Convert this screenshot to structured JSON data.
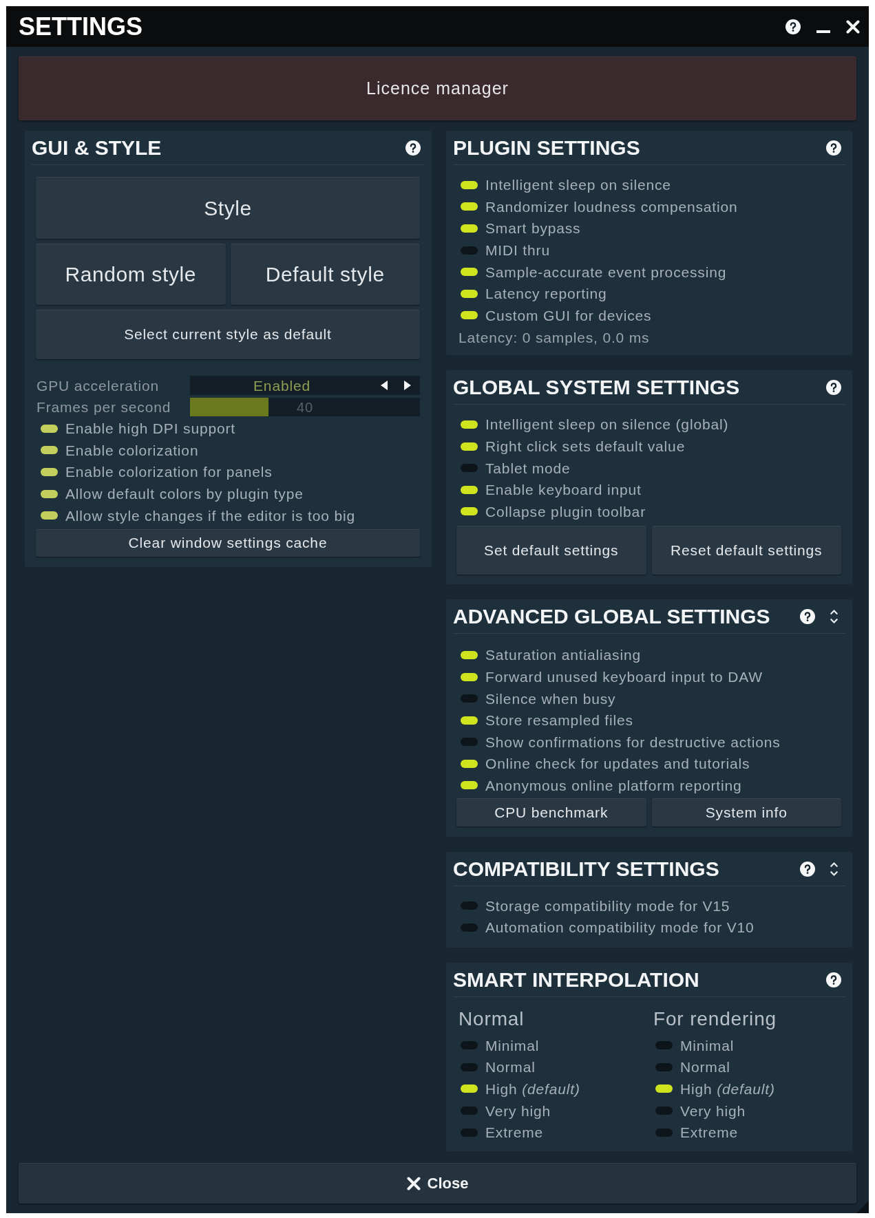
{
  "window": {
    "title": "SETTINGS"
  },
  "licence_button": "Licence manager",
  "gui_style": {
    "title": "GUI & STYLE",
    "collapsible": false,
    "style_button": "Style",
    "style_buttons": [
      "Random style",
      "Default style"
    ],
    "select_default_button": "Select current style as default",
    "gpu_acceleration": {
      "label": "GPU acceleration",
      "value": "Enabled"
    },
    "frames_per_second": {
      "label": "Frames per second",
      "level": 0.34,
      "reading": "40"
    },
    "options": [
      {
        "label": "Enable high DPI support",
        "on": true
      },
      {
        "label": "Enable colorization",
        "on": true
      },
      {
        "label": "Enable colorization for panels",
        "on": true
      },
      {
        "label": "Allow default colors by plugin type",
        "on": true
      },
      {
        "label": "Allow style changes if the editor is too big",
        "on": true
      }
    ],
    "clear_cache_button": "Clear window settings cache"
  },
  "plugin_settings": {
    "title": "PLUGIN SETTINGS",
    "collapsible": false,
    "options": [
      {
        "label": "Intelligent sleep on silence",
        "on": true
      },
      {
        "label": "Randomizer loudness compensation",
        "on": true
      },
      {
        "label": "Smart bypass",
        "on": true
      },
      {
        "label": "MIDI thru",
        "on": false
      },
      {
        "label": "Sample-accurate event processing",
        "on": true
      },
      {
        "label": "Latency reporting",
        "on": true
      },
      {
        "label": "Custom GUI for devices",
        "on": true
      }
    ],
    "latency": "Latency: 0 samples, 0.0 ms"
  },
  "global_system_settings": {
    "title": "GLOBAL SYSTEM SETTINGS",
    "collapsible": false,
    "options": [
      {
        "label": "Intelligent sleep on silence (global)",
        "on": true
      },
      {
        "label": "Right click sets default value",
        "on": true
      },
      {
        "label": "Tablet mode",
        "on": false
      },
      {
        "label": "Enable keyboard input",
        "on": true
      },
      {
        "label": "Collapse plugin toolbar",
        "on": true
      }
    ],
    "buttons": [
      "Set default settings",
      "Reset default settings"
    ]
  },
  "advanced_global_settings": {
    "title": "ADVANCED GLOBAL SETTINGS",
    "collapsible": true,
    "options": [
      {
        "label": "Saturation antialiasing",
        "on": true
      },
      {
        "label": "Forward unused keyboard input to DAW",
        "on": true
      },
      {
        "label": "Silence when busy",
        "on": false
      },
      {
        "label": "Store resampled files",
        "on": true
      },
      {
        "label": "Show confirmations for destructive actions",
        "on": false
      },
      {
        "label": "Online check for updates and tutorials",
        "on": true
      },
      {
        "label": "Anonymous online platform reporting",
        "on": true
      }
    ],
    "buttons": [
      "CPU benchmark",
      "System info"
    ]
  },
  "compatibility_settings": {
    "title": "COMPATIBILITY SETTINGS",
    "collapsible": true,
    "options": [
      {
        "label": "Storage compatibility mode for V15",
        "on": false
      },
      {
        "label": "Automation compatibility mode for V10",
        "on": false
      }
    ]
  },
  "smart_interpolation": {
    "title": "SMART INTERPOLATION",
    "collapsible": false,
    "groups": [
      {
        "heading": "Normal",
        "levels": [
          {
            "label": "Minimal",
            "selected": false
          },
          {
            "label": "Normal",
            "selected": false
          },
          {
            "label": "High *(default)*",
            "selected": true
          },
          {
            "label": "Very high",
            "selected": false
          },
          {
            "label": "Extreme",
            "selected": false
          }
        ]
      },
      {
        "heading": "For rendering",
        "levels": [
          {
            "label": "Minimal",
            "selected": false
          },
          {
            "label": "Normal",
            "selected": false
          },
          {
            "label": "High *(default)*",
            "selected": true
          },
          {
            "label": "Very high",
            "selected": false
          },
          {
            "label": "Extreme",
            "selected": false
          }
        ]
      }
    ]
  },
  "close_button": "Close"
}
